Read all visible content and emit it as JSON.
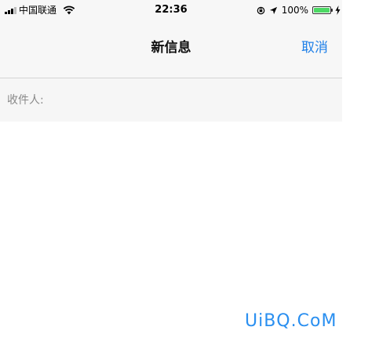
{
  "status_bar": {
    "carrier": "中国联通",
    "time": "22:36",
    "battery_percent": "100%",
    "battery_level": 1.0,
    "icons": [
      "signal-icon",
      "wifi-icon",
      "rotation-lock-icon",
      "location-arrow-icon",
      "battery-icon",
      "charging-bolt-icon"
    ]
  },
  "nav": {
    "title": "新信息",
    "cancel_label": "取消"
  },
  "compose": {
    "recipient_label": "收件人:",
    "recipient_value": ""
  },
  "watermark": {
    "text": "UiBQ.CoM"
  },
  "colors": {
    "accent": "#1d7fe8",
    "battery": "#4cd964",
    "watermark": "#2a8ff0"
  }
}
